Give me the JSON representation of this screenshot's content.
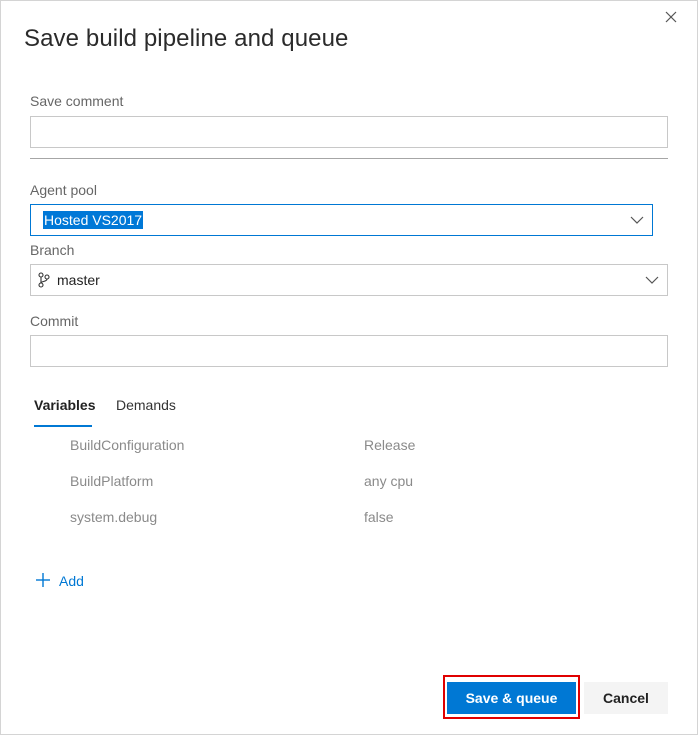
{
  "dialog": {
    "title": "Save build pipeline and queue"
  },
  "save_comment": {
    "label": "Save comment",
    "value": ""
  },
  "agent_pool": {
    "label": "Agent pool",
    "selected": "Hosted VS2017"
  },
  "branch": {
    "label": "Branch",
    "selected": "master"
  },
  "commit": {
    "label": "Commit",
    "value": ""
  },
  "tabs": [
    {
      "label": "Variables",
      "active": true
    },
    {
      "label": "Demands",
      "active": false
    }
  ],
  "variables": [
    {
      "name": "BuildConfiguration",
      "value": "Release"
    },
    {
      "name": "BuildPlatform",
      "value": "any cpu"
    },
    {
      "name": "system.debug",
      "value": "false"
    }
  ],
  "add_label": "Add",
  "buttons": {
    "save_queue": "Save & queue",
    "cancel": "Cancel"
  },
  "colors": {
    "accent": "#0078d4",
    "highlight_box": "#e00000",
    "selection_bg": "#0078d7"
  },
  "icons": {
    "close": "close-icon",
    "dropdown": "chevron-down-icon",
    "branch": "git-branch-icon",
    "add": "plus-icon"
  }
}
